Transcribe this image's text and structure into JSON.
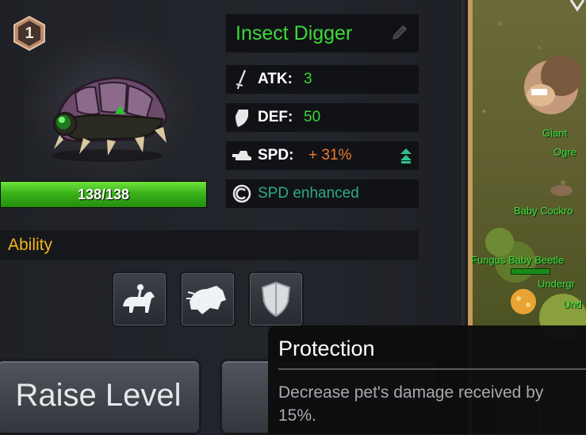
{
  "pet": {
    "level": "1",
    "name": "Insect Digger",
    "hp_text": "138/138",
    "hp_fraction": 1.0,
    "image": "insect-digger-sprite"
  },
  "stats": {
    "atk": {
      "label": "ATK:",
      "value": "3",
      "icon": "sword-icon",
      "color": "#39d639"
    },
    "def": {
      "label": "DEF:",
      "value": "50",
      "icon": "shield-icon",
      "color": "#39d639"
    },
    "spd": {
      "label": "SPD:",
      "value": "+ 31%",
      "icon": "boot-icon",
      "color": "#ee7a2a",
      "trend_icon": "double-up-arrow-icon"
    },
    "enhanced": {
      "text": "SPD enhanced",
      "icon": "enhance-icon",
      "color": "#2ea88a"
    }
  },
  "ability": {
    "title": "Ability",
    "skills": [
      {
        "icon": "mount-rider-icon"
      },
      {
        "icon": "beast-dash-icon"
      },
      {
        "icon": "protection-shield-icon"
      }
    ]
  },
  "buttons": {
    "raise_level": "Raise Level"
  },
  "map": {
    "labels": {
      "giant_line1": "Giant",
      "giant_line2": "Ogre",
      "cockroach": "Baby Cockro",
      "beetle": "Fungus Baby Beetle",
      "underground1": "Undergr",
      "underground2": "Und"
    }
  },
  "tooltip": {
    "title": "Protection",
    "description": "Decrease pet's damage received by 15%."
  },
  "colors": {
    "name_green": "#3bd93b",
    "ability_gold": "#f2b51a",
    "hp_green": "#3ab31a"
  }
}
